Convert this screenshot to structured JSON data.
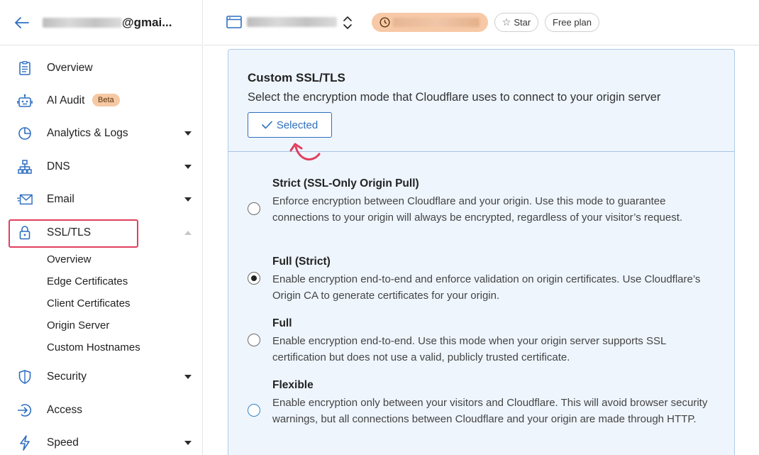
{
  "sidebar": {
    "account_suffix": "@gmai...",
    "nav": [
      {
        "label": "Overview",
        "icon": "document-icon"
      },
      {
        "label": "AI Audit",
        "icon": "robot-icon",
        "badge": "Beta"
      },
      {
        "label": "Analytics & Logs",
        "icon": "pie-chart-icon"
      },
      {
        "label": "DNS",
        "icon": "network-icon"
      },
      {
        "label": "Email",
        "icon": "envelope-icon"
      },
      {
        "label": "SSL/TLS",
        "icon": "lock-icon"
      },
      {
        "label": "Security",
        "icon": "shield-icon"
      },
      {
        "label": "Access",
        "icon": "access-icon"
      },
      {
        "label": "Speed",
        "icon": "bolt-icon"
      }
    ],
    "ssl_subitems": [
      "Overview",
      "Edge Certificates",
      "Client Certificates",
      "Origin Server",
      "Custom Hostnames"
    ]
  },
  "topbar": {
    "star_label": "Star",
    "plan_label": "Free plan"
  },
  "ssl_card": {
    "title": "Custom SSL/TLS",
    "description": "Select the encryption mode that Cloudflare uses to connect to your origin server",
    "selected_label": "Selected",
    "options": [
      {
        "title": "Strict (SSL-Only Origin Pull)",
        "description": "Enforce encryption between Cloudflare and your origin. Use this mode to guarantee connections to your origin will always be encrypted, regardless of your visitor’s request.",
        "checked": false
      },
      {
        "title": "Full (Strict)",
        "description": "Enable encryption end-to-end and enforce validation on origin certificates. Use Cloudflare’s Origin CA to generate certificates for your origin.",
        "checked": true
      },
      {
        "title": "Full",
        "description": "Enable encryption end-to-end. Use this mode when your origin server supports SSL certification but does not use a valid, publicly trusted certificate.",
        "checked": false
      },
      {
        "title": "Flexible",
        "description": "Enable encryption only between your visitors and Cloudflare. This will avoid browser security warnings, but all connections between Cloudflare and your origin are made through HTTP.",
        "checked": false
      }
    ]
  },
  "colors": {
    "accent": "#2e6fc0",
    "highlight": "#e0405f",
    "card_bg": "#eef5fd",
    "card_border": "#aecbe8",
    "plan_pill": "#f7c9a6"
  }
}
